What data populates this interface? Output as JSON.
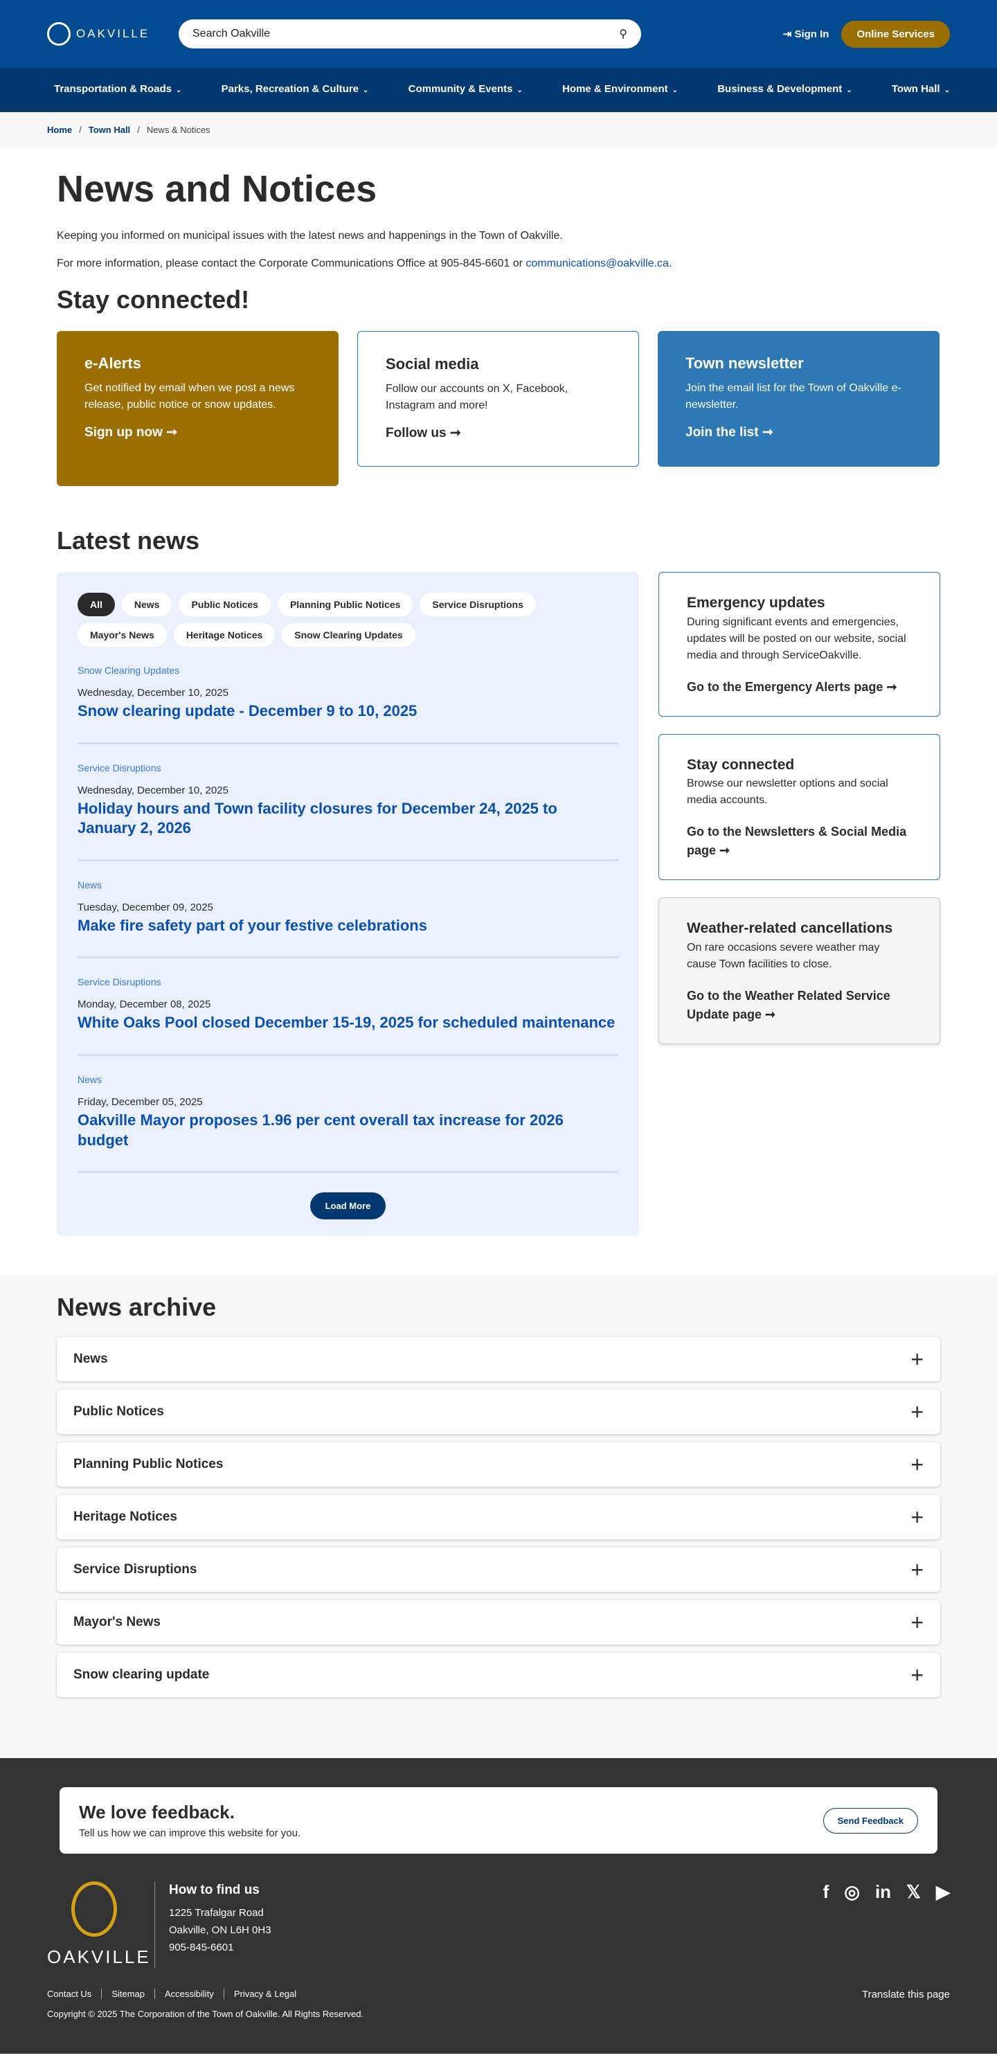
{
  "header": {
    "logo": "OAKVILLE",
    "search_placeholder": "Search Oakville",
    "sign_in": "Sign In",
    "online_services": "Online Services"
  },
  "nav": [
    "Transportation & Roads",
    "Parks, Recreation & Culture",
    "Community & Events",
    "Home & Environment",
    "Business & Development",
    "Town Hall"
  ],
  "breadcrumb": [
    "Home",
    "Town Hall",
    "News & Notices"
  ],
  "page": {
    "title": "News and Notices",
    "intro": "Keeping you informed on municipal issues with the latest news and happenings in the Town of Oakville.",
    "contact_prefix": "For more information, please contact the Corporate Communications Office at 905-845-6601 or ",
    "contact_email": "communications@oakville.ca",
    "contact_suffix": "."
  },
  "stay": {
    "heading": "Stay connected!",
    "cards": [
      {
        "title": "e-Alerts",
        "text": "Get notified by email when we post a news release, public notice or snow updates.",
        "cta": "Sign up now ➞"
      },
      {
        "title": "Social media",
        "text": "Follow our accounts on X, Facebook, Instagram and more!",
        "cta": "Follow us ➞"
      },
      {
        "title": "Town newsletter",
        "text": "Join the email list for the Town of Oakville e-newsletter.",
        "cta": "Join the list ➞"
      }
    ]
  },
  "latest": {
    "heading": "Latest news",
    "filters": [
      "All",
      "News",
      "Public Notices",
      "Planning Public Notices",
      "Service Disruptions",
      "Mayor's News",
      "Heritage Notices",
      "Snow Clearing Updates"
    ],
    "items": [
      {
        "category": "Snow Clearing Updates",
        "date": "Wednesday, December 10, 2025",
        "title": "Snow clearing update - December 9 to 10, 2025"
      },
      {
        "category": "Service Disruptions",
        "date": "Wednesday, December 10, 2025",
        "title": "Holiday hours and Town facility closures for December 24, 2025 to January 2, 2026"
      },
      {
        "category": "News",
        "date": "Tuesday, December 09, 2025",
        "title": "Make fire safety part of your festive celebrations"
      },
      {
        "category": "Service Disruptions",
        "date": "Monday, December 08, 2025",
        "title": "White Oaks Pool closed December 15-19, 2025 for scheduled maintenance"
      },
      {
        "category": "News",
        "date": "Friday, December 05, 2025",
        "title": "Oakville Mayor proposes 1.96 per cent overall tax increase for 2026 budget"
      }
    ],
    "load_more": "Load More"
  },
  "side": [
    {
      "title": "Emergency updates",
      "text": "During significant events and emergencies, updates will be posted on our website, social media and through ServiceOakville.",
      "cta": "Go to the Emergency Alerts page ➞"
    },
    {
      "title": "Stay connected",
      "text": "Browse our newsletter options and social media accounts.",
      "cta": "Go to the Newsletters & Social Media page ➞"
    },
    {
      "title": "Weather-related cancellations",
      "text": "On rare occasions severe weather may cause Town facilities to close.",
      "cta": "Go to the Weather Related Service Update page ➞"
    }
  ],
  "archive": {
    "heading": "News archive",
    "items": [
      "News",
      "Public Notices",
      "Planning Public Notices",
      "Heritage Notices",
      "Service Disruptions",
      "Mayor's News",
      "Snow clearing update"
    ]
  },
  "footer": {
    "feedback_title": "We love feedback.",
    "feedback_text": "Tell us how we can improve this website for you.",
    "feedback_button": "Send Feedback",
    "logo": "OAKVILLE",
    "find_heading": "How to find us",
    "address": [
      "1225 Trafalgar Road",
      "Oakville, ON L6H 0H3",
      "905-845-6601"
    ],
    "links": [
      "Contact Us",
      "Sitemap",
      "Accessibility",
      "Privacy & Legal"
    ],
    "translate": "Translate this page",
    "copyright": "Copyright © 2025 The Corporation of the Town of Oakville. All Rights Reserved."
  }
}
